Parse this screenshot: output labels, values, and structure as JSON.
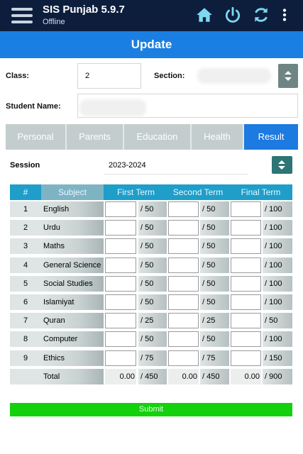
{
  "app": {
    "title": "SIS Punjab 5.9.7",
    "status": "Offline"
  },
  "page_title": "Update",
  "form": {
    "class_label": "Class:",
    "class_value": "2",
    "section_label": "Section:",
    "section_value": "",
    "student_name_label": "Student Name:",
    "student_name_value": ""
  },
  "tabs": [
    {
      "label": "Personal",
      "active": false
    },
    {
      "label": "Parents",
      "active": false
    },
    {
      "label": "Education",
      "active": false
    },
    {
      "label": "Health",
      "active": false
    },
    {
      "label": "Result",
      "active": true
    }
  ],
  "session": {
    "label": "Session",
    "value": "2023-2024"
  },
  "table": {
    "headers": {
      "num": "#",
      "subject": "Subject",
      "first": "First Term",
      "second": "Second Term",
      "final": "Final Term"
    },
    "rows": [
      {
        "num": "1",
        "subject": "English",
        "first": "/ 50",
        "second": "/ 50",
        "final": "/ 100"
      },
      {
        "num": "2",
        "subject": "Urdu",
        "first": "/ 50",
        "second": "/ 50",
        "final": "/ 100"
      },
      {
        "num": "3",
        "subject": "Maths",
        "first": "/ 50",
        "second": "/ 50",
        "final": "/ 100"
      },
      {
        "num": "4",
        "subject": "General Science",
        "first": "/ 50",
        "second": "/ 50",
        "final": "/ 100"
      },
      {
        "num": "5",
        "subject": "Social Studies",
        "first": "/ 50",
        "second": "/ 50",
        "final": "/ 100"
      },
      {
        "num": "6",
        "subject": "Islamiyat",
        "first": "/ 50",
        "second": "/ 50",
        "final": "/ 100"
      },
      {
        "num": "7",
        "subject": "Quran",
        "first": "/ 25",
        "second": "/ 25",
        "final": "/ 50"
      },
      {
        "num": "8",
        "subject": "Computer",
        "first": "/ 50",
        "second": "/ 50",
        "final": "/ 100"
      },
      {
        "num": "9",
        "subject": "Ethics",
        "first": "/ 75",
        "second": "/ 75",
        "final": "/ 150"
      }
    ],
    "total": {
      "label": "Total",
      "first_obtained": "0.00",
      "first_max": "/ 450",
      "second_obtained": "0.00",
      "second_max": "/ 450",
      "final_obtained": "0.00",
      "final_max": "/ 900"
    }
  },
  "submit_label": "Submit",
  "icons": [
    "menu-icon",
    "home-icon",
    "power-icon",
    "refresh-icon",
    "more-vert-icon",
    "dropdown-icon"
  ],
  "colors": {
    "appbar": "#0d1e3d",
    "titlebar": "#1a7fe0",
    "active_tab": "#1c7ae0",
    "table_header": "#1e9ec9",
    "submit": "#14d10d"
  }
}
